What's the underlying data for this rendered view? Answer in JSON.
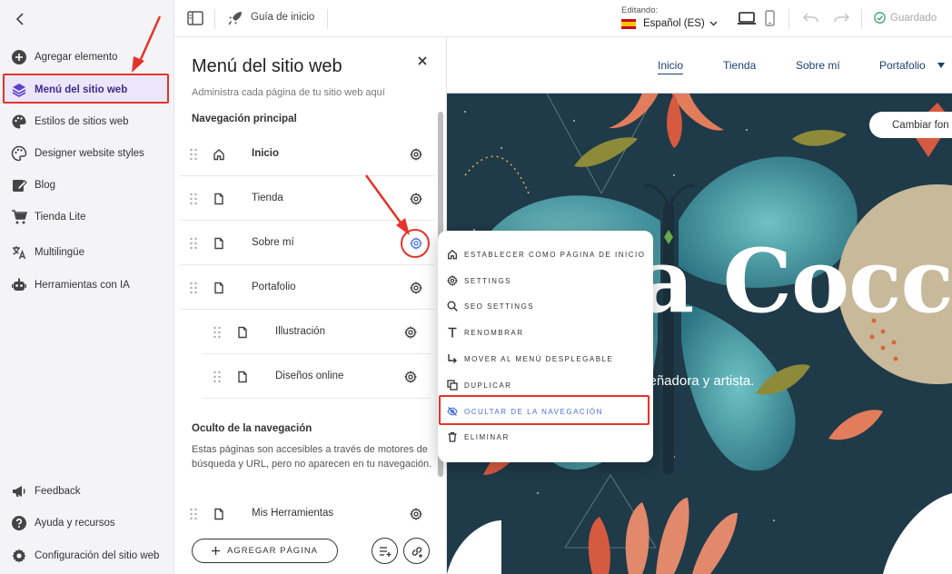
{
  "sidebar": {
    "items": [
      {
        "label": "Agregar elemento",
        "icon": "plus-circle-icon"
      },
      {
        "label": "Menú del sitio web",
        "icon": "layers-icon"
      },
      {
        "label": "Estilos de sitios web",
        "icon": "palette-icon"
      },
      {
        "label": "Designer website styles",
        "icon": "palette-icon"
      },
      {
        "label": "Blog",
        "icon": "edit-icon"
      },
      {
        "label": "Tienda Lite",
        "icon": "cart-icon"
      },
      {
        "label": "Multilingüe",
        "icon": "translate-icon"
      },
      {
        "label": "Herramientas con IA",
        "icon": "robot-icon"
      }
    ],
    "bottom": [
      {
        "label": "Feedback",
        "icon": "megaphone-icon"
      },
      {
        "label": "Ayuda y recursos",
        "icon": "help-icon"
      },
      {
        "label": "Configuración del sitio web",
        "icon": "gear-icon"
      }
    ]
  },
  "topbar": {
    "guide_label": "Guía de inicio",
    "editing_label": "Editando:",
    "language": "Español (ES)",
    "saved_label": "Guardado"
  },
  "panel": {
    "title": "Menú del sitio web",
    "subtitle": "Administra cada página de tu sitio web aquí",
    "main_nav_title": "Navegación principal",
    "pages": [
      {
        "label": "Inicio",
        "icon": "home-icon"
      },
      {
        "label": "Tienda",
        "icon": "page-icon"
      },
      {
        "label": "Sobre mí",
        "icon": "page-icon"
      },
      {
        "label": "Portafolio",
        "icon": "page-icon"
      },
      {
        "label": "Illustración",
        "icon": "page-icon"
      },
      {
        "label": "Diseños online",
        "icon": "page-icon"
      }
    ],
    "hidden_title": "Oculto de la navegación",
    "hidden_desc": "Estas páginas son accesibles a través de motores de búsqueda y URL, pero no aparecen en tu navegación.",
    "hidden_pages": [
      {
        "label": "Mis Herramientas",
        "icon": "page-icon"
      }
    ],
    "add_page_label": "AGREGAR PÁGINA"
  },
  "context_menu": {
    "items": [
      {
        "label": "ESTABLECER COMO PÁGINA DE INICIO",
        "icon": "home-icon"
      },
      {
        "label": "SETTINGS",
        "icon": "gear-icon"
      },
      {
        "label": "SEO SETTINGS",
        "icon": "search-icon"
      },
      {
        "label": "RENOMBRAR",
        "icon": "text-icon"
      },
      {
        "label": "MOVER AL MENÚ DESPLEGABLE",
        "icon": "arrow-down-right-icon"
      },
      {
        "label": "DUPLICAR",
        "icon": "copy-icon"
      },
      {
        "label": "OCULTAR DE LA NAVEGACIÓN",
        "icon": "eye-off-icon"
      },
      {
        "label": "ELIMINAR",
        "icon": "trash-icon"
      }
    ]
  },
  "site": {
    "nav": [
      "Inicio",
      "Tienda",
      "Sobre mí",
      "Portafolio"
    ],
    "change_bg_label": "Cambiar fon",
    "hero_title": "a Cocco",
    "hero_subtitle": "señadora y artista."
  },
  "colors": {
    "accent": "#5b3fd0",
    "annotation_red": "#e5332a",
    "highlight_blue": "#4b6fd6",
    "hero_bg": "#1f3a48"
  }
}
